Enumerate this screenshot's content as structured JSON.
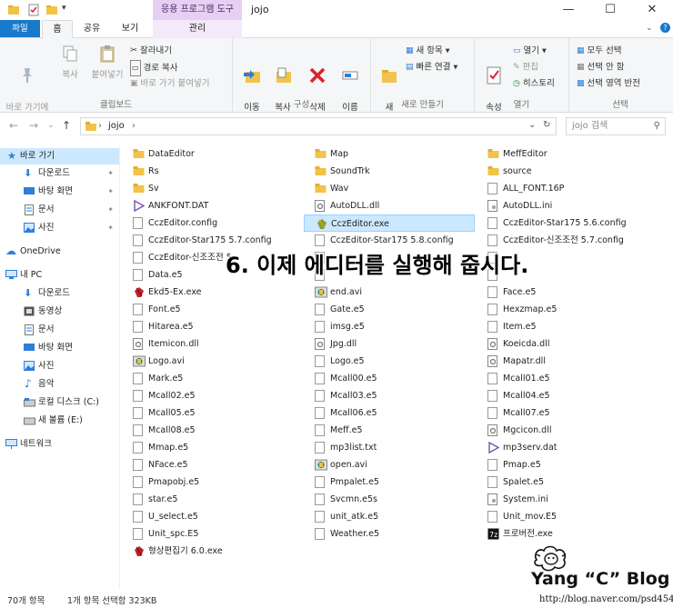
{
  "window": {
    "title": "jojo",
    "context_tab_group": "응용 프로그램 도구",
    "controls": {
      "minimize": "—",
      "maximize": "☐",
      "close": "✕"
    },
    "qa_dropdown": "▾"
  },
  "ribbon_tabs": [
    {
      "label": "파일"
    },
    {
      "label": "홈"
    },
    {
      "label": "공유"
    },
    {
      "label": "보기"
    },
    {
      "label": "관리"
    }
  ],
  "ribbon": {
    "clipboard": {
      "label": "클립보드",
      "pin": "바로 가기에\n고정",
      "copy": "복사",
      "paste": "붙여넣기",
      "cut": "잘라내기",
      "copy_path": "경로 복사",
      "paste_shortcut": "바로 가기 붙여넣기"
    },
    "organize": {
      "label": "구성",
      "move_to": "이동\n위치 ▾",
      "copy_to": "복사\n위치 ▾",
      "delete": "삭제\n▾",
      "rename": "이름\n바꾸기"
    },
    "new": {
      "label": "새로 만들기",
      "new_folder": "새\n폴더",
      "new_item": "새 항목 ▾",
      "easy_access": "빠른 연결 ▾"
    },
    "open": {
      "label": "열기",
      "properties": "속성\n▾",
      "open": "열기 ▾",
      "edit": "편집",
      "history": "히스토리"
    },
    "select": {
      "label": "선택",
      "select_all": "모두 선택",
      "select_none": "선택 안 함",
      "invert": "선택 영역 반전"
    }
  },
  "nav": {
    "back": "←",
    "forward": "→",
    "recent": "⌄",
    "up": "↑",
    "address_sep1": "›",
    "address": "jojo",
    "address_sep2": "›",
    "dropdown": "⌄",
    "refresh": "↻",
    "search_placeholder": "jojo 검색"
  },
  "navpane": {
    "pin_glyph": "✦",
    "items": [
      {
        "label": "바로 가기",
        "icon": "star"
      },
      {
        "label": "다운로드",
        "icon": "download"
      },
      {
        "label": "바탕 화면",
        "icon": "desktop"
      },
      {
        "label": "문서",
        "icon": "document"
      },
      {
        "label": "사진",
        "icon": "picture"
      },
      {
        "label": "OneDrive",
        "icon": "cloud"
      },
      {
        "label": "내 PC",
        "icon": "pc"
      },
      {
        "label": "다운로드",
        "icon": "download"
      },
      {
        "label": "동영상",
        "icon": "video"
      },
      {
        "label": "문서",
        "icon": "document"
      },
      {
        "label": "바탕 화면",
        "icon": "desktop"
      },
      {
        "label": "사진",
        "icon": "picture"
      },
      {
        "label": "음악",
        "icon": "music"
      },
      {
        "label": "로컬 디스크 (C:)",
        "icon": "disk"
      },
      {
        "label": "새 볼륨 (E:)",
        "icon": "drive"
      },
      {
        "label": "네트워크",
        "icon": "network"
      }
    ]
  },
  "files": {
    "col1": [
      {
        "name": "DataEditor",
        "icon": "folder"
      },
      {
        "name": "Rs",
        "icon": "folder"
      },
      {
        "name": "Sv",
        "icon": "folder"
      },
      {
        "name": "ANKFONT.DAT",
        "icon": "media"
      },
      {
        "name": "CczEditor.config",
        "icon": "file"
      },
      {
        "name": "CczEditor-Star175 5.7.config",
        "icon": "file"
      },
      {
        "name": "CczEditor-신조조전 5",
        "icon": "file"
      },
      {
        "name": "Data.e5",
        "icon": "file"
      },
      {
        "name": "Ekd5-Ex.exe",
        "icon": "red-exe"
      },
      {
        "name": "Font.e5",
        "icon": "file"
      },
      {
        "name": "Hitarea.e5",
        "icon": "file"
      },
      {
        "name": "Itemicon.dll",
        "icon": "dll"
      },
      {
        "name": "Logo.avi",
        "icon": "avi"
      },
      {
        "name": "Mark.e5",
        "icon": "file"
      },
      {
        "name": "Mcall02.e5",
        "icon": "file"
      },
      {
        "name": "Mcall05.e5",
        "icon": "file"
      },
      {
        "name": "Mcall08.e5",
        "icon": "file"
      },
      {
        "name": "Mmap.e5",
        "icon": "file"
      },
      {
        "name": "NFace.e5",
        "icon": "file"
      },
      {
        "name": "Pmapobj.e5",
        "icon": "file"
      },
      {
        "name": "star.e5",
        "icon": "file"
      },
      {
        "name": "U_select.e5",
        "icon": "file"
      },
      {
        "name": "Unit_spc.E5",
        "icon": "file"
      },
      {
        "name": "형상편집기 6.0.exe",
        "icon": "red-exe"
      }
    ],
    "col2": [
      {
        "name": "Map",
        "icon": "folder"
      },
      {
        "name": "SoundTrk",
        "icon": "folder"
      },
      {
        "name": "Wav",
        "icon": "folder"
      },
      {
        "name": "AutoDLL.dll",
        "icon": "dll"
      },
      {
        "name": "CczEditor.exe",
        "icon": "green-exe",
        "selected": true
      },
      {
        "name": "CczEditor-Star175 5.8.config",
        "icon": "file"
      },
      {
        "name": "",
        "icon": "file"
      },
      {
        "name": "",
        "icon": "file"
      },
      {
        "name": "end.avi",
        "icon": "avi"
      },
      {
        "name": "Gate.e5",
        "icon": "file"
      },
      {
        "name": "imsg.e5",
        "icon": "file"
      },
      {
        "name": "Jpg.dll",
        "icon": "dll"
      },
      {
        "name": "Logo.e5",
        "icon": "file"
      },
      {
        "name": "Mcall00.e5",
        "icon": "file"
      },
      {
        "name": "Mcall03.e5",
        "icon": "file"
      },
      {
        "name": "Mcall06.e5",
        "icon": "file"
      },
      {
        "name": "Meff.e5",
        "icon": "file"
      },
      {
        "name": "mp3list.txt",
        "icon": "file"
      },
      {
        "name": "open.avi",
        "icon": "avi"
      },
      {
        "name": "Pmpalet.e5",
        "icon": "file"
      },
      {
        "name": "Svcmn.e5s",
        "icon": "file"
      },
      {
        "name": "unit_atk.e5",
        "icon": "file"
      },
      {
        "name": "Weather.e5",
        "icon": "file"
      }
    ],
    "col3": [
      {
        "name": "MeffEditor",
        "icon": "folder"
      },
      {
        "name": "source",
        "icon": "folder"
      },
      {
        "name": "ALL_FONT.16P",
        "icon": "file"
      },
      {
        "name": "AutoDLL.ini",
        "icon": "ini"
      },
      {
        "name": "CczEditor-Star175 5.6.config",
        "icon": "file"
      },
      {
        "name": "CczEditor-신조조전 5.7.config",
        "icon": "file"
      },
      {
        "name": "",
        "icon": "file"
      },
      {
        "name": "",
        "icon": "file"
      },
      {
        "name": "Face.e5",
        "icon": "file"
      },
      {
        "name": "Hexzmap.e5",
        "icon": "file"
      },
      {
        "name": "Item.e5",
        "icon": "file"
      },
      {
        "name": "Koeicda.dll",
        "icon": "dll"
      },
      {
        "name": "Mapatr.dll",
        "icon": "dll"
      },
      {
        "name": "Mcall01.e5",
        "icon": "file"
      },
      {
        "name": "Mcall04.e5",
        "icon": "file"
      },
      {
        "name": "Mcall07.e5",
        "icon": "file"
      },
      {
        "name": "Mgcicon.dll",
        "icon": "dll"
      },
      {
        "name": "mp3serv.dat",
        "icon": "media"
      },
      {
        "name": "Pmap.e5",
        "icon": "file"
      },
      {
        "name": "Spalet.e5",
        "icon": "file"
      },
      {
        "name": "System.ini",
        "icon": "ini"
      },
      {
        "name": "Unit_mov.E5",
        "icon": "file"
      },
      {
        "name": "프로버전.exe",
        "icon": "7z"
      }
    ]
  },
  "caption": "6. 이제 에디터를 실행해 줍시다.",
  "status": {
    "count": "70개 항목",
    "selection": "1개 항목 선택함 323KB"
  },
  "watermark": {
    "title": "Yang “C” Blog",
    "url": "http://blog.naver.com/psd4548"
  }
}
